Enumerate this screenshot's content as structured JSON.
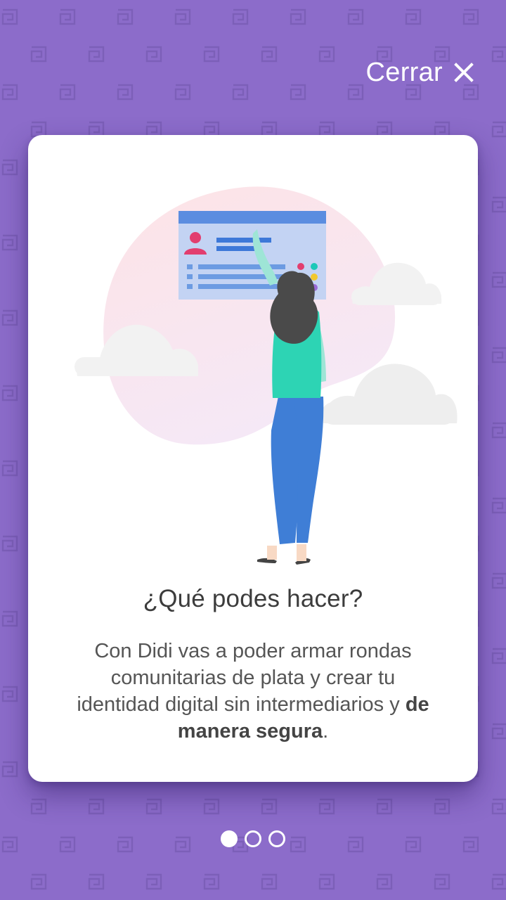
{
  "header": {
    "close_label": "Cerrar"
  },
  "card": {
    "title": "¿Qué podes hacer?",
    "description_regular": "Con Didi vas a poder armar rondas comunitarias de plata y crear tu identidad digital sin intermediarios y ",
    "description_bold": "de manera segura",
    "description_end": "."
  },
  "pager": {
    "total": 3,
    "current": 1
  },
  "colors": {
    "background": "#8c6cca",
    "pattern": "#7f62bb",
    "card": "#ffffff",
    "title_text": "#3c3c3c",
    "body_text": "#555555"
  },
  "icons": {
    "close": "close-icon",
    "illustration": "woman-touching-identity-card-illustration"
  }
}
